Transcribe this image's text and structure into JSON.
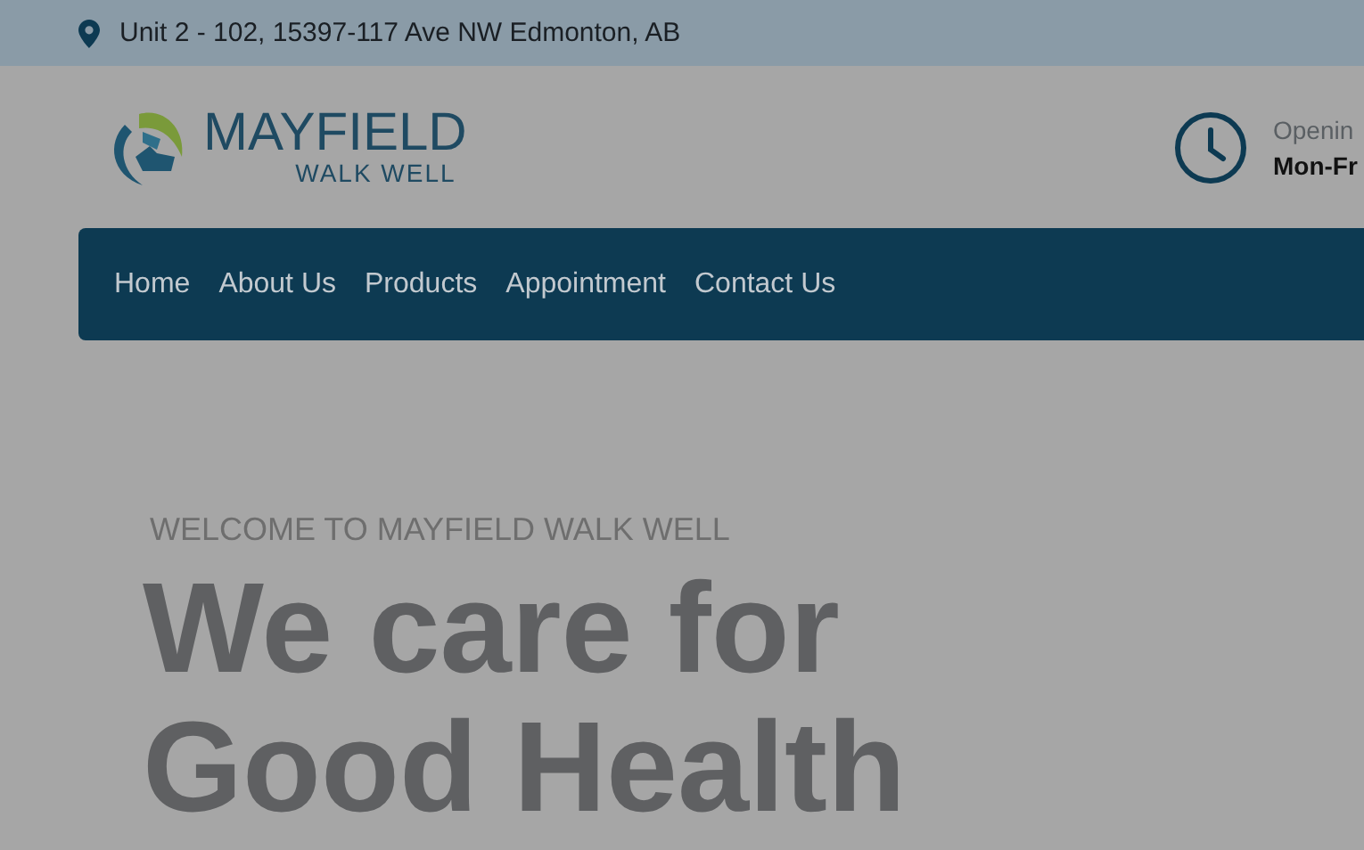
{
  "top_bar": {
    "address": "Unit 2 - 102, 15397-117 Ave NW Edmonton, AB"
  },
  "header": {
    "logo": {
      "name": "MAYFIELD",
      "tagline": "WALK WELL"
    },
    "hours": {
      "label": "Openin",
      "value": "Mon-Fr"
    }
  },
  "nav": {
    "items": [
      {
        "label": "Home"
      },
      {
        "label": "About Us"
      },
      {
        "label": "Products"
      },
      {
        "label": "Appointment"
      },
      {
        "label": "Contact Us"
      }
    ]
  },
  "hero": {
    "eyebrow": "WELCOME TO MAYFIELD WALK WELL",
    "heading_lines": [
      "We care for",
      "Good Health"
    ]
  }
}
